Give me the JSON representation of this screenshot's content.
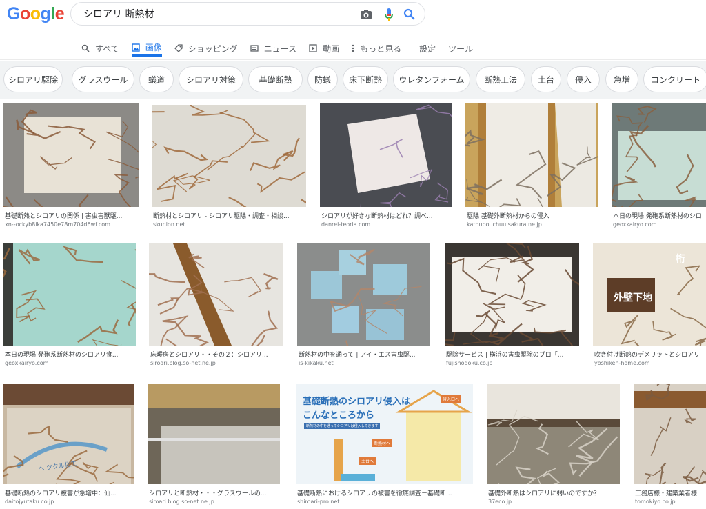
{
  "search": {
    "query": "シロアリ 断熱材"
  },
  "logo": {
    "letters": [
      "G",
      "o",
      "o",
      "g",
      "l",
      "e"
    ],
    "colors": [
      "#4285f4",
      "#ea4335",
      "#fbbc05",
      "#4285f4",
      "#34a853",
      "#ea4335"
    ]
  },
  "nav": [
    {
      "label": "すべて",
      "icon": "search-icon"
    },
    {
      "label": "画像",
      "icon": "image-icon",
      "active": true
    },
    {
      "label": "ショッピング",
      "icon": "tag-icon"
    },
    {
      "label": "ニュース",
      "icon": "news-icon"
    },
    {
      "label": "動画",
      "icon": "play-icon"
    },
    {
      "label": "もっと見る",
      "icon": "more-icon"
    },
    {
      "label": "設定"
    },
    {
      "label": "ツール"
    }
  ],
  "chips": [
    "シロアリ駆除",
    "グラスウール",
    "蟻道",
    "シロアリ対策",
    "基礎断熱",
    "防蟻",
    "床下断熱",
    "ウレタンフォーム",
    "断熱工法",
    "土台",
    "侵入",
    "急増",
    "コンクリート"
  ],
  "results": [
    {
      "caption": "基礎断熱とシロアリの関係 | 害虫害獣駆...",
      "source": "xn--ockyb8ika7450e78m704d6wf.com"
    },
    {
      "caption": "断熱材とシロアリ - シロアリ駆除・調査・相談...",
      "source": "skunion.net"
    },
    {
      "caption": "シロアリが好きな断熱材はどれ？調べ...",
      "source": "danrei-teoria.com"
    },
    {
      "caption": "駆除 基礎外断熱材からの侵入",
      "source": "katoubouchuu.sakura.ne.jp"
    },
    {
      "caption": "本日の現場 発砲系断熱材のシロ",
      "source": "geoxkairyo.com"
    },
    {
      "caption": "本日の現場 発砲系断熱材のシロアリ食...",
      "source": "geoxkairyo.com"
    },
    {
      "caption": "床暖房とシロアリ・・その２：シロアリ...",
      "source": "siroari.blog.so-net.ne.jp"
    },
    {
      "caption": "断熱材の中を通って | アイ・エス害虫駆...",
      "source": "is-kikaku.net"
    },
    {
      "caption": "駆除サービス | 横浜の害虫駆除のプロ「...",
      "source": "fujishodoku.co.jp"
    },
    {
      "caption": "吹き付け断熱のデメリットとシロアリ",
      "source": "yoshiken-home.com"
    },
    {
      "caption": "基礎断熱のシロアリ被害が急増中：仙...",
      "source": "daitojyutaku.co.jp"
    },
    {
      "caption": "シロアリと断熱材・・・グラスウールの...",
      "source": "siroari.blog.so-net.ne.jp"
    },
    {
      "caption": "基礎断熱におけるシロアリの被害を徹底調査－基礎断...",
      "source": "shiroari-pro.net"
    },
    {
      "caption": "基礎外断熱はシロアリに弱いのですか？",
      "source": "37eco.jp"
    },
    {
      "caption": "工務店様・建築業者様",
      "source": "tomokiyo.co.jp"
    }
  ],
  "image_texts": {
    "r10_kanji": "桁",
    "r10_label": "外壁下地",
    "r11_text": "ヘ ツクル化工",
    "r13_title_1": "基礎断熱のシロアリ侵入は",
    "r13_title_2": "こんなところから",
    "r13_note": "断熱材の中を通ってシロアリは侵入してきます",
    "r13_tag1": "侵入口へ",
    "r13_tag2": "断熱材へ",
    "r13_tag3": "土台へ"
  }
}
